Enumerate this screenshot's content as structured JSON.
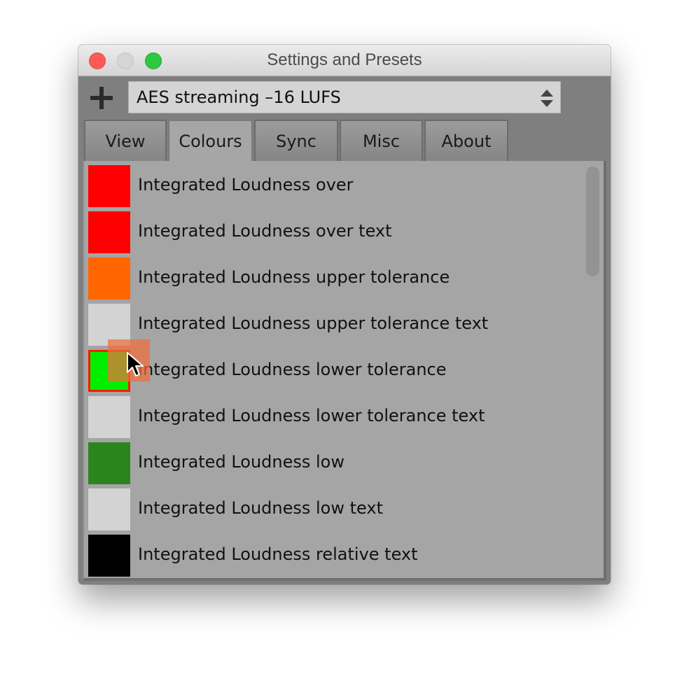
{
  "window": {
    "title": "Settings and Presets",
    "controls": [
      "close",
      "minimize",
      "maximize"
    ]
  },
  "toolbar": {
    "add_button_icon": "plus-icon",
    "preset": {
      "selected": "AES streaming –16 LUFS",
      "icon": "up-down-stepper-icon"
    }
  },
  "tabs": [
    {
      "label": "View",
      "active": false
    },
    {
      "label": "Colours",
      "active": true
    },
    {
      "label": "Sync",
      "active": false
    },
    {
      "label": "Misc",
      "active": false
    },
    {
      "label": "About",
      "active": false
    }
  ],
  "colours": [
    {
      "label": "Integrated Loudness over",
      "color": "#ff0000"
    },
    {
      "label": "Integrated Loudness over text",
      "color": "#ff0000"
    },
    {
      "label": "Integrated Loudness upper tolerance",
      "color": "#ff6600"
    },
    {
      "label": "Integrated Loudness upper tolerance text",
      "color": "#d3d3d3"
    },
    {
      "label": "Integrated Loudness lower tolerance",
      "color": "#00ee00",
      "selected": true,
      "selection_color": "#ff1a00"
    },
    {
      "label": "Integrated Loudness lower tolerance text",
      "color": "#d3d3d3"
    },
    {
      "label": "Integrated Loudness low",
      "color": "#2a861c"
    },
    {
      "label": "Integrated Loudness low text",
      "color": "#d3d3d3"
    },
    {
      "label": "Integrated Loudness relative text",
      "color": "#000000"
    }
  ],
  "drag": {
    "dragging_color": "#ff6600",
    "cursor_icon": "arrow-cursor-icon"
  }
}
